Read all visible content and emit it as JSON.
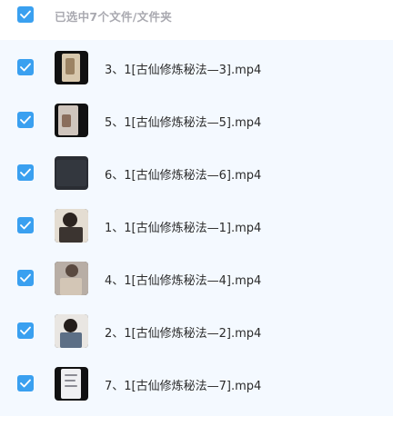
{
  "header": {
    "selection_text": "已选中7个文件/文件夹",
    "select_all_icon": "check-icon"
  },
  "colors": {
    "accent": "#3aa0f0",
    "list_background": "#f4f9ff",
    "header_text": "#a9a9b0"
  },
  "files": [
    {
      "name": "3、1[古仙修炼秘法—3].mp4",
      "checked": true,
      "thumb": "video-thumbnail"
    },
    {
      "name": "5、1[古仙修炼秘法—5].mp4",
      "checked": true,
      "thumb": "video-thumbnail"
    },
    {
      "name": "6、1[古仙修炼秘法—6].mp4",
      "checked": true,
      "thumb": "video-thumbnail"
    },
    {
      "name": "1、1[古仙修炼秘法—1].mp4",
      "checked": true,
      "thumb": "video-thumbnail"
    },
    {
      "name": "4、1[古仙修炼秘法—4].mp4",
      "checked": true,
      "thumb": "video-thumbnail"
    },
    {
      "name": "2、1[古仙修炼秘法—2].mp4",
      "checked": true,
      "thumb": "video-thumbnail"
    },
    {
      "name": "7、1[古仙修炼秘法—7].mp4",
      "checked": true,
      "thumb": "video-thumbnail"
    }
  ]
}
